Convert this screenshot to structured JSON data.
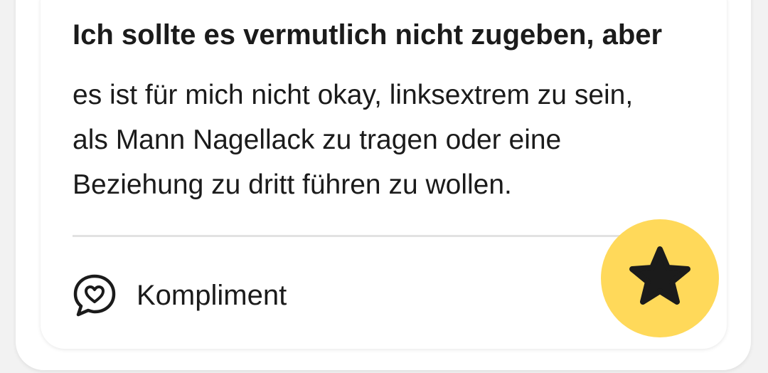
{
  "card": {
    "prompt": "Ich sollte es vermutlich nicht zugeben, aber",
    "answer": "es ist für mich nicht okay, linksextrem zu sein, als Mann Nagellack zu tragen oder eine Beziehung zu dritt führen zu wollen."
  },
  "actions": {
    "compliment_label": "Kompliment",
    "compliment_icon": "heart-speech-bubble-icon",
    "star_icon": "star-icon",
    "star_color": "#ffd95a"
  }
}
